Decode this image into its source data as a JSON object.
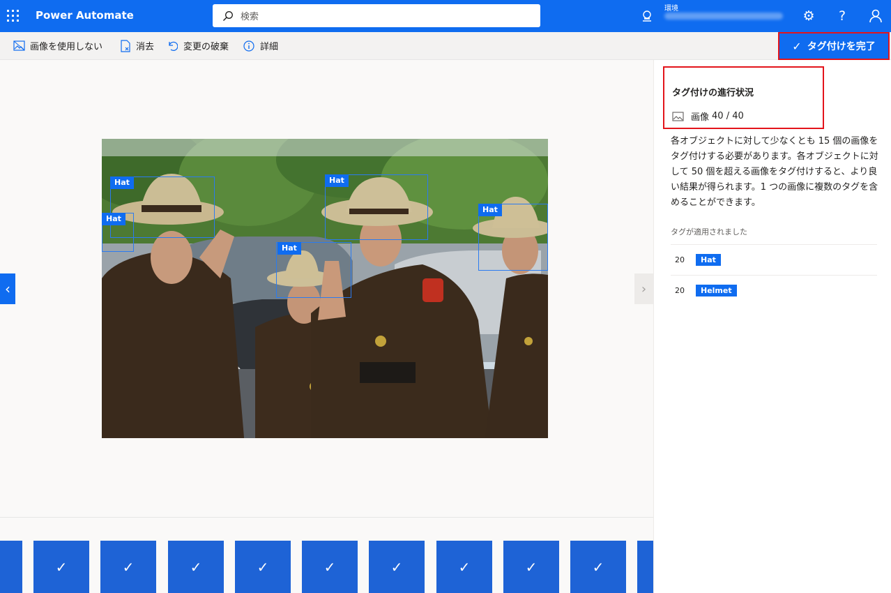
{
  "header": {
    "app_title": "Power Automate",
    "search_placeholder": "検索",
    "env_label": "環境"
  },
  "toolbar": {
    "no_image_label": "画像を使用しない",
    "clear_label": "消去",
    "discard_label": "変更の破棄",
    "details_label": "詳細",
    "finish_label": "タグ付けを完了"
  },
  "image_tags": [
    {
      "label": "Hat"
    },
    {
      "label": "Hat"
    },
    {
      "label": "Hat"
    },
    {
      "label": "Hat"
    },
    {
      "label": "Hat"
    }
  ],
  "panel": {
    "progress_title": "タグ付けの進行状況",
    "images_label": "画像",
    "images_count": "40 / 40",
    "description": "各オブジェクトに対して少なくとも 15 個の画像をタグ付けする必要があります。各オブジェクトに対して 50 個を超える画像をタグ付けすると、より良い結果が得られます。1 つの画像に複数のタグを含めることができます。",
    "applied_label": "タグが適用されました",
    "tags": [
      {
        "count": "20",
        "name": "Hat"
      },
      {
        "count": "20",
        "name": "Helmet"
      }
    ]
  },
  "colors": {
    "brand_blue": "#0f6cf0",
    "highlight_red": "#e3141b"
  },
  "icons": [
    "waffle-icon",
    "search-icon",
    "environment-icon",
    "settings-icon",
    "help-icon",
    "account-icon",
    "no-image-icon",
    "clear-icon",
    "undo-icon",
    "info-icon",
    "checkmark-icon",
    "chevron-left-icon",
    "chevron-right-icon",
    "image-icon"
  ]
}
